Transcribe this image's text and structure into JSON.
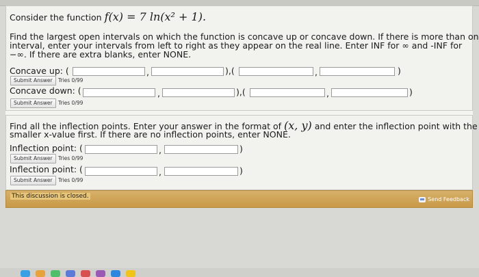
{
  "q1": {
    "intro": "Consider the function",
    "function_tex": "f(x) = 7 ln(x² + 1).",
    "instructions": [
      "Find the largest open intervals on which the function is concave up or concave down. If there is more than one",
      "interval, enter your intervals from left to right as they appear on the real line. Enter INF for ∞ and -INF for",
      "−∞. If there are extra blanks, enter NONE."
    ],
    "concave_up_label": "Concave up: (",
    "concave_down_label": "Concave down: (",
    "comma": ",",
    "between": "),(",
    "close": ")",
    "submit_label": "Submit Answer",
    "tries": "Tries 0/99"
  },
  "q2": {
    "line1_pre": "Find all the inflection points. Enter your answer in the format of",
    "line1_math": "(x, y)",
    "line1_post": "and enter the inflection point with the",
    "line2": "smaller x-value first. If there are no inflection points, enter NONE.",
    "inflection_label": "Inflection point: (",
    "comma": ",",
    "close": ")",
    "submit_label": "Submit Answer",
    "tries": "Tries 0/99"
  },
  "footer": {
    "closed_text": "This discussion is closed.",
    "feedback_label": "Send Feedback"
  }
}
